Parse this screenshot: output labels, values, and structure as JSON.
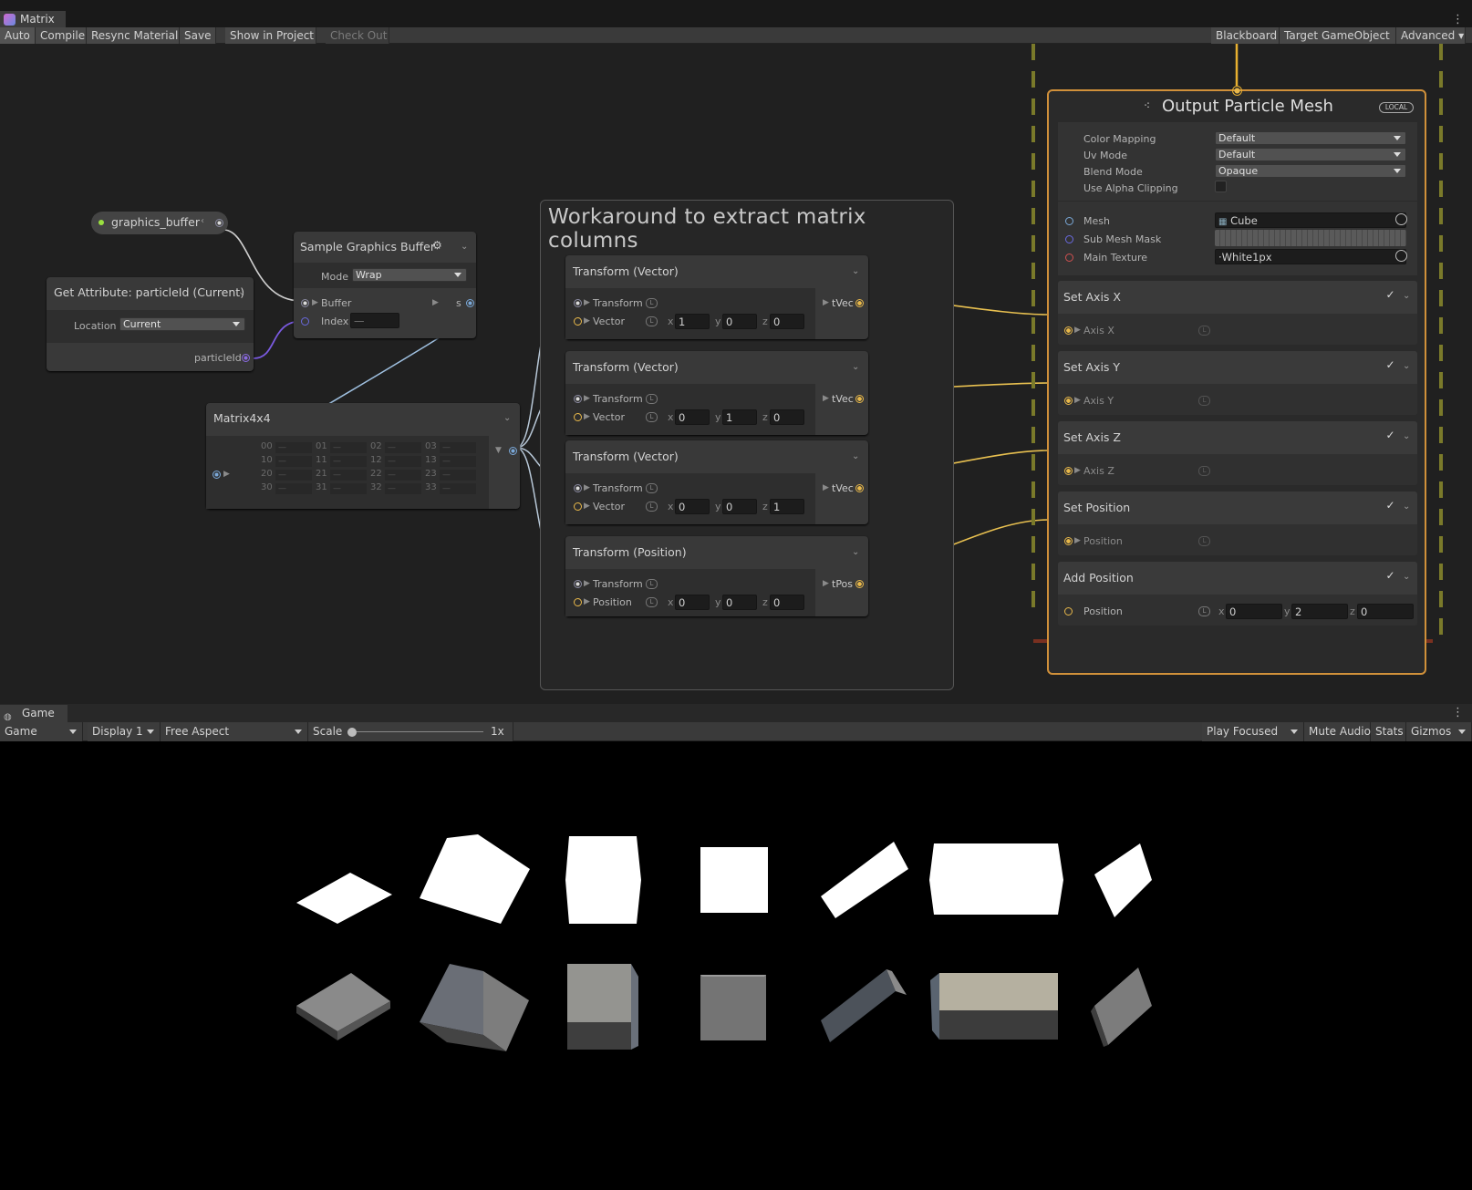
{
  "window": {
    "tab_title": "Matrix",
    "toolbar_left": [
      "Auto",
      "Compile",
      "Resync Material",
      "Save",
      "Show in Project",
      "Check Out"
    ],
    "toolbar_right": [
      "Blackboard",
      "Target GameObject",
      "Advanced"
    ]
  },
  "graph": {
    "graphics_buffer_param": "graphics_buffer",
    "get_attribute": {
      "title": "Get Attribute: particleId (Current)",
      "location_label": "Location",
      "location_value": "Current",
      "output_label": "particleId"
    },
    "sample_buffer": {
      "title": "Sample Graphics Buffer",
      "mode_label": "Mode",
      "mode_value": "Wrap",
      "buffer_label": "Buffer",
      "index_label": "Index",
      "index_value": "—",
      "output_label": "s"
    },
    "matrix": {
      "title": "Matrix4x4",
      "cells": [
        [
          "00",
          "01",
          "02",
          "03"
        ],
        [
          "10",
          "11",
          "12",
          "13"
        ],
        [
          "20",
          "21",
          "22",
          "23"
        ],
        [
          "30",
          "31",
          "32",
          "33"
        ]
      ],
      "cell_value": "—"
    },
    "sticky_title": "Workaround to extract matrix columns",
    "transforms": [
      {
        "title": "Transform (Vector)",
        "in1": "Transform",
        "in2": "Vector",
        "x": "1",
        "y": "0",
        "z": "0",
        "out": "tVec"
      },
      {
        "title": "Transform (Vector)",
        "in1": "Transform",
        "in2": "Vector",
        "x": "0",
        "y": "1",
        "z": "0",
        "out": "tVec"
      },
      {
        "title": "Transform (Vector)",
        "in1": "Transform",
        "in2": "Vector",
        "x": "0",
        "y": "0",
        "z": "1",
        "out": "tVec"
      },
      {
        "title": "Transform (Position)",
        "in1": "Transform",
        "in2": "Position",
        "x": "0",
        "y": "0",
        "z": "0",
        "out": "tPos"
      }
    ],
    "axis_labels": {
      "x": "x",
      "y": "y",
      "z": "z"
    },
    "output": {
      "title": "Output Particle Mesh",
      "badge": "LOCAL",
      "settings": [
        {
          "label": "Color Mapping",
          "value": "Default"
        },
        {
          "label": "Uv Mode",
          "value": "Default"
        },
        {
          "label": "Blend Mode",
          "value": "Opaque"
        },
        {
          "label": "Use Alpha Clipping",
          "value": ""
        }
      ],
      "mesh_label": "Mesh",
      "mesh_value": "Cube",
      "submesh_label": "Sub Mesh Mask",
      "texture_label": "Main Texture",
      "texture_value": "White1px",
      "blocks": [
        {
          "title": "Set Axis X",
          "port": "Axis X"
        },
        {
          "title": "Set Axis Y",
          "port": "Axis Y"
        },
        {
          "title": "Set Axis Z",
          "port": "Axis Z"
        },
        {
          "title": "Set Position",
          "port": "Position"
        },
        {
          "title": "Add Position",
          "port": "Position",
          "x": "0",
          "y": "2",
          "z": "0"
        }
      ]
    }
  },
  "game": {
    "tab_title": "Game",
    "game_dd": "Game",
    "display": "Display 1",
    "aspect": "Free Aspect",
    "scale_label": "Scale",
    "scale_value": "1x",
    "play_mode": "Play Focused",
    "right_buttons": [
      "Mute Audio",
      "Stats",
      "Gizmos"
    ]
  },
  "colors": {
    "graph_bg": "#202020",
    "float_port": "#e8b84a",
    "output_border": "#d0903a",
    "system_dash_yellow": "#7a7a2a",
    "system_dash_red": "#7a3020"
  }
}
